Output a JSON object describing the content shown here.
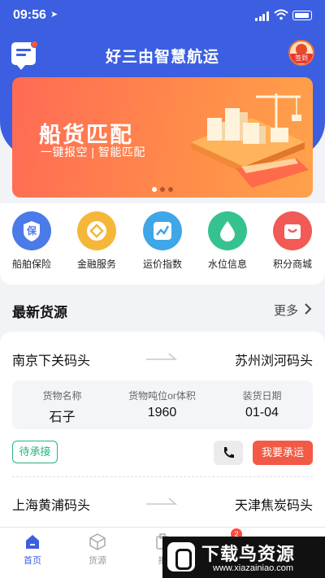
{
  "status_bar": {
    "time": "09:56",
    "location_glyph": "➤"
  },
  "header": {
    "title": "好三由智慧航运",
    "sign_in_label": "签到"
  },
  "banner": {
    "title": "船货匹配",
    "subtitle": "一键报空 | 智能匹配",
    "page_count": 3,
    "active_index": 0
  },
  "quick_menu": [
    {
      "label": "船舶保险",
      "icon": "shield-insurance-icon",
      "color": "#4a7be8",
      "glyph": "保"
    },
    {
      "label": "金融服务",
      "icon": "coin-finance-icon",
      "color": "#f5b73a",
      "glyph": "◇"
    },
    {
      "label": "运价指数",
      "icon": "chart-index-icon",
      "color": "#3fa6e8",
      "glyph": ""
    },
    {
      "label": "水位信息",
      "icon": "water-drop-icon",
      "color": "#36c28f",
      "glyph": ""
    },
    {
      "label": "积分商城",
      "icon": "shopping-bag-icon",
      "color": "#f25a55",
      "glyph": ""
    }
  ],
  "section": {
    "title": "最新货源",
    "more": "更多"
  },
  "cargo": {
    "from": "南京下关码头",
    "to": "苏州浏河码头",
    "fields": [
      {
        "label": "货物名称",
        "value": "石子"
      },
      {
        "label": "货物吨位or体积",
        "value": "1960"
      },
      {
        "label": "装货日期",
        "value": "01-04"
      }
    ],
    "status": "待承接",
    "action": "我要承运"
  },
  "cargo_next": {
    "from": "上海黄浦码头",
    "to": "天津焦炭码头"
  },
  "tabbar": [
    {
      "label": "首页",
      "icon": "home-icon",
      "active": true
    },
    {
      "label": "货源",
      "icon": "cube-icon",
      "active": false
    },
    {
      "label": "报",
      "icon": "report-icon",
      "active": false
    },
    {
      "label": "",
      "icon": "message-icon",
      "active": false
    },
    {
      "label": "",
      "icon": "user-icon",
      "active": false
    }
  ],
  "tab_badge": "2",
  "watermark": {
    "name": "下载鸟资源",
    "url": "www.xiazainiao.com"
  },
  "colors": {
    "primary": "#3b5fe0",
    "accent": "#f25a45",
    "success": "#2ab37a"
  }
}
